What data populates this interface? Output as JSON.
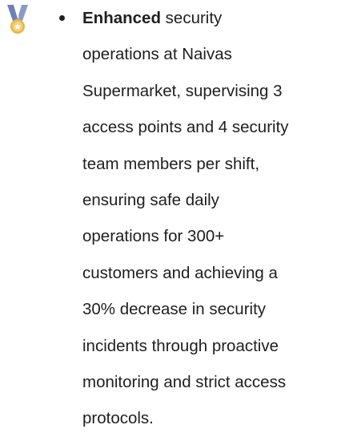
{
  "bullet": {
    "icon": "medal-icon",
    "lead": "Enhanced",
    "lines": [
      " security",
      "operations at Naivas",
      "Supermarket, supervising 3",
      "access points and 4 security",
      "team members per shift,",
      "ensuring safe daily",
      "operations for 300+",
      "customers and achieving a",
      "30% decrease in security",
      "incidents through proactive",
      "monitoring and strict access",
      "protocols."
    ]
  },
  "colors": {
    "text": "#1f1f1f",
    "ribbon": "#6f7fb5",
    "medal": "#e8b64a"
  }
}
